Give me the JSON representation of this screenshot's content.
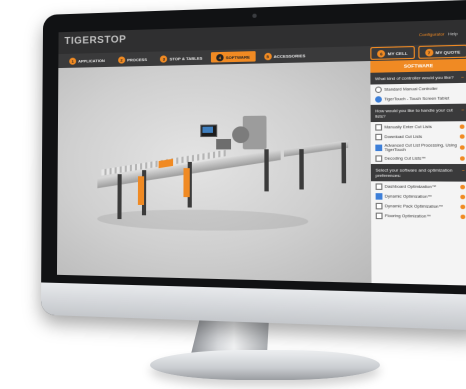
{
  "app": {
    "brand": "TIGERSTOP",
    "meta_label": "Configurator",
    "meta_help": "Help"
  },
  "tabs": [
    {
      "num": "1",
      "label": "APPLICATION"
    },
    {
      "num": "2",
      "label": "PROCESS"
    },
    {
      "num": "3",
      "label": "STOP & TABLES"
    },
    {
      "num": "4",
      "label": "SOFTWARE"
    },
    {
      "num": "5",
      "label": "ACCESSORIES"
    },
    {
      "num": "6",
      "label": "MY CELL"
    },
    {
      "num": "7",
      "label": "MY QUOTE"
    }
  ],
  "panel": {
    "title": "SOFTWARE",
    "q1": "What kind of controller would you like?",
    "q1_options": [
      {
        "label": "Standard Manual Controller",
        "selected": false
      },
      {
        "label": "TigerTouch - Touch Screen Tablet",
        "selected": true
      }
    ],
    "q2": "How would you like to handle your cut lists?",
    "q2_options": [
      {
        "label": "Manually Enter Cut Lists",
        "selected": false
      },
      {
        "label": "Download Cut Lists",
        "selected": false
      },
      {
        "label": "Advanced Cut List Processing, Using TigerTouch",
        "selected": true
      },
      {
        "label": "Decoding Cut Lists™",
        "selected": false
      }
    ],
    "q3": "Select your software and optimization preferences:",
    "q3_options": [
      {
        "label": "Dashboard Optimization™",
        "selected": false
      },
      {
        "label": "Dynamic Optimization™",
        "selected": true
      },
      {
        "label": "Dynamic Pack Optimization™",
        "selected": false
      },
      {
        "label": "Flooring Optimization™",
        "selected": false
      }
    ]
  },
  "colors": {
    "accent": "#f08a23",
    "nav_bg": "#2f2f30",
    "panel_bg": "#f4f4f4",
    "checked": "#3d7fd8"
  }
}
